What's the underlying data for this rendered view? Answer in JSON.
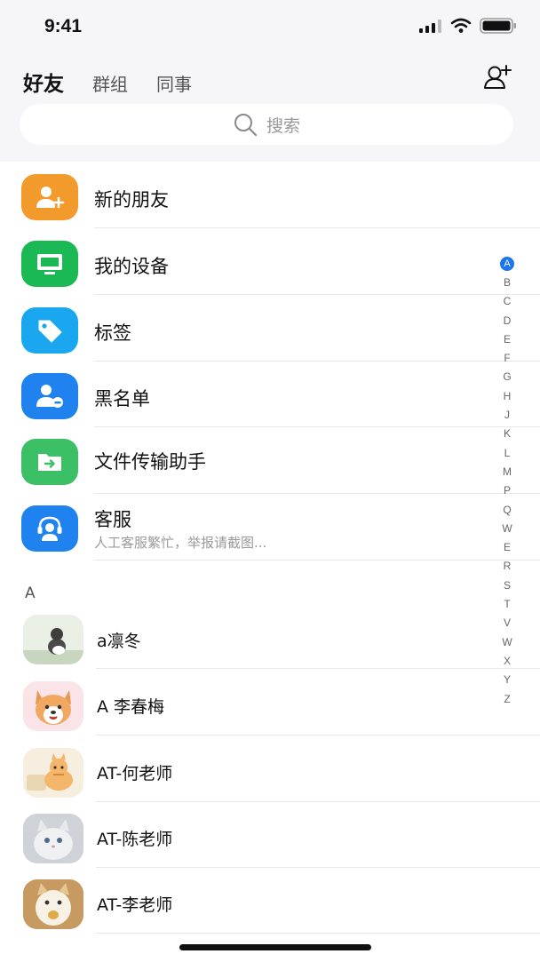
{
  "status_bar": {
    "time": "9:41"
  },
  "tabs": [
    {
      "label": "好友",
      "active": true
    },
    {
      "label": "群组",
      "active": false
    },
    {
      "label": "同事",
      "active": false
    }
  ],
  "search": {
    "placeholder": "搜索"
  },
  "menu": [
    {
      "label": "新的朋友",
      "icon": "add-user-icon",
      "color": "#f39a2c"
    },
    {
      "label": "我的设备",
      "icon": "monitor-icon",
      "color": "#1bb954"
    },
    {
      "label": "标签",
      "icon": "tag-icon",
      "color": "#1aa7f0"
    },
    {
      "label": "黑名单",
      "icon": "block-user-icon",
      "color": "#1f82ee"
    },
    {
      "label": "文件传输助手",
      "icon": "folder-transfer-icon",
      "color": "#3cc065"
    },
    {
      "label": "客服",
      "sub": "人工客服繁忙，举报请截图...",
      "icon": "headset-icon",
      "color": "#1f82ee"
    }
  ],
  "section": {
    "letter": "A"
  },
  "contacts": [
    {
      "name": "a凛冬"
    },
    {
      "name": "A 李春梅"
    },
    {
      "name": "AT-何老师"
    },
    {
      "name": "AT-陈老师"
    },
    {
      "name": "AT-李老师"
    }
  ],
  "az_index": [
    "A",
    "B",
    "C",
    "D",
    "E",
    "F",
    "G",
    "H",
    "J",
    "K",
    "L",
    "M",
    "P",
    "Q",
    "W",
    "E",
    "R",
    "S",
    "T",
    "V",
    "W",
    "X",
    "Y",
    "Z"
  ],
  "colors": {
    "accent": "#1976f0",
    "background_top": "#f6f6f8"
  }
}
